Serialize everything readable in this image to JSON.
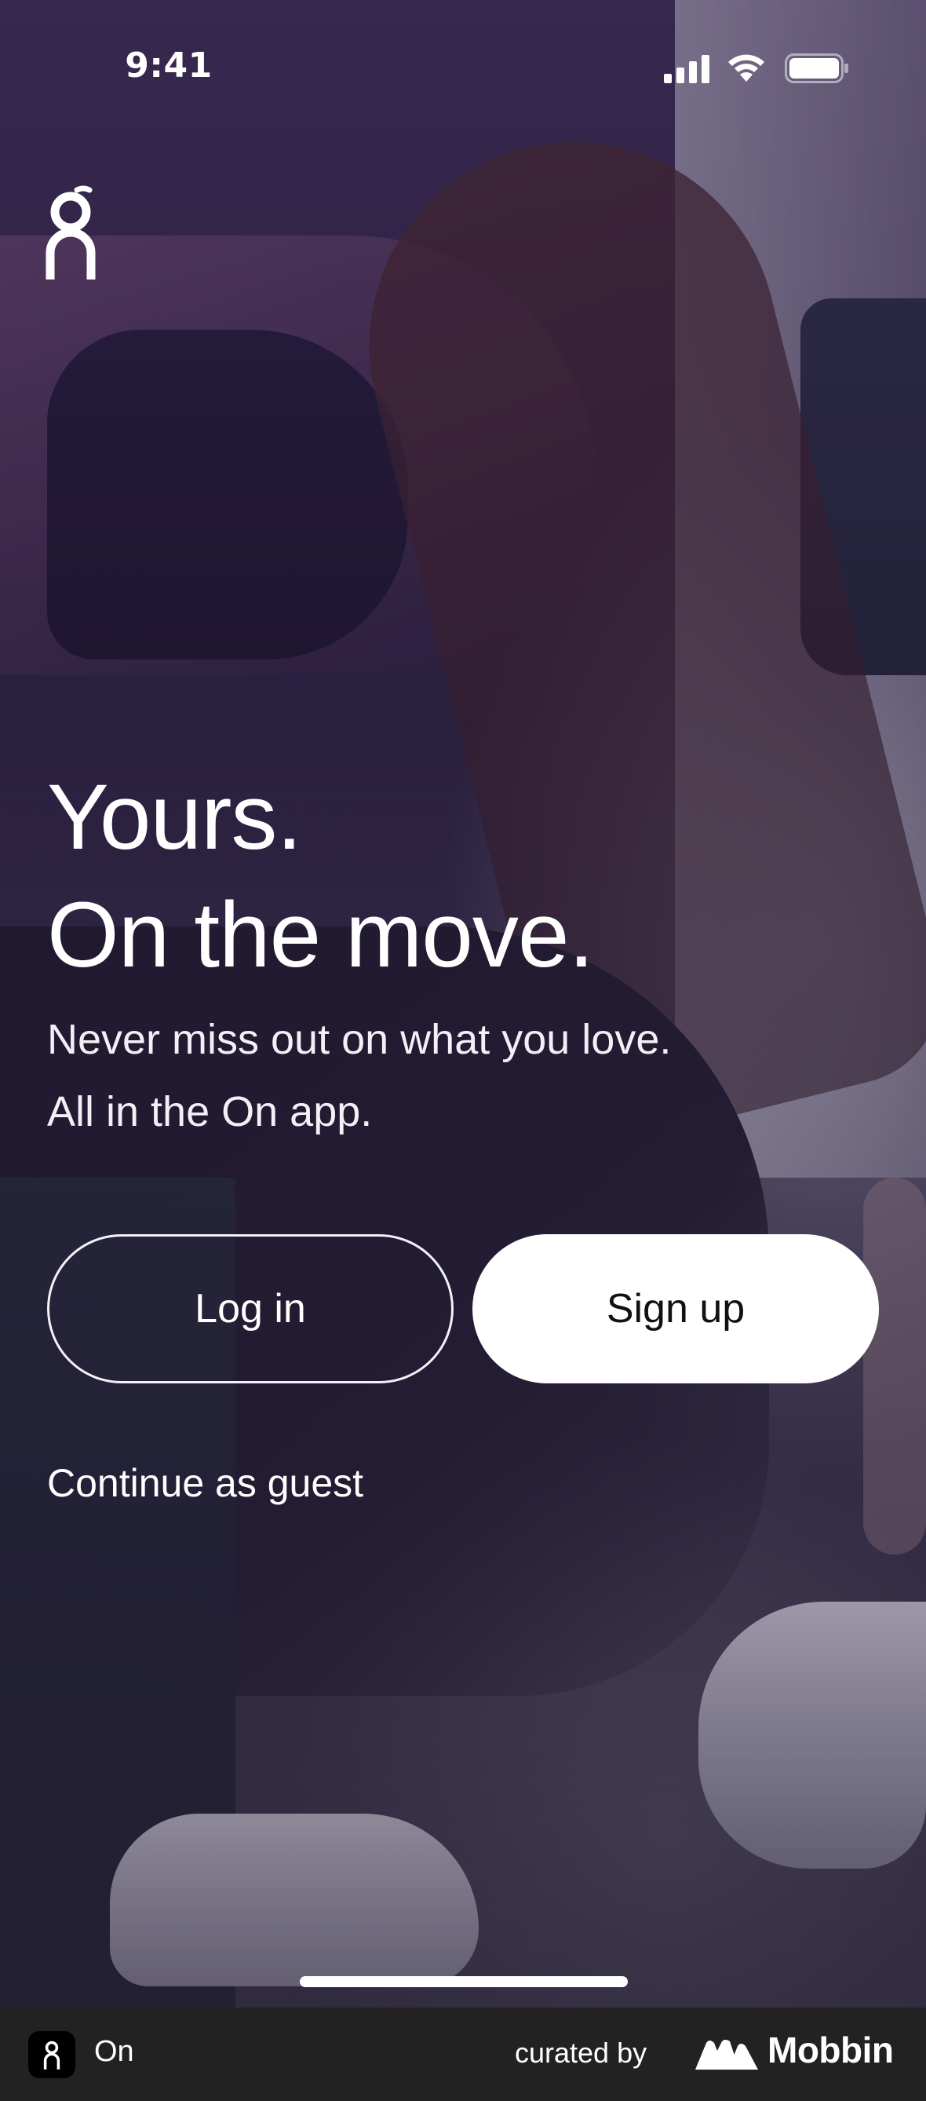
{
  "status_bar": {
    "time": "9:41",
    "icons": [
      "signal-icon",
      "wifi-icon",
      "battery-icon"
    ]
  },
  "brand": {
    "logo_icon": "on-logo-icon"
  },
  "hero": {
    "headline_line1": "Yours.",
    "headline_line2": "On the move.",
    "subline_line1": "Never miss out on what you love.",
    "subline_line2": "All in the On app."
  },
  "actions": {
    "login_label": "Log in",
    "signup_label": "Sign up",
    "guest_label": "Continue as guest"
  },
  "footer": {
    "app_name": "On",
    "curated_label": "curated by",
    "mobbin_label": "Mobbin"
  },
  "colors": {
    "primary_button_bg": "#ffffff",
    "primary_button_text": "#111111",
    "footer_bg": "#222222"
  }
}
